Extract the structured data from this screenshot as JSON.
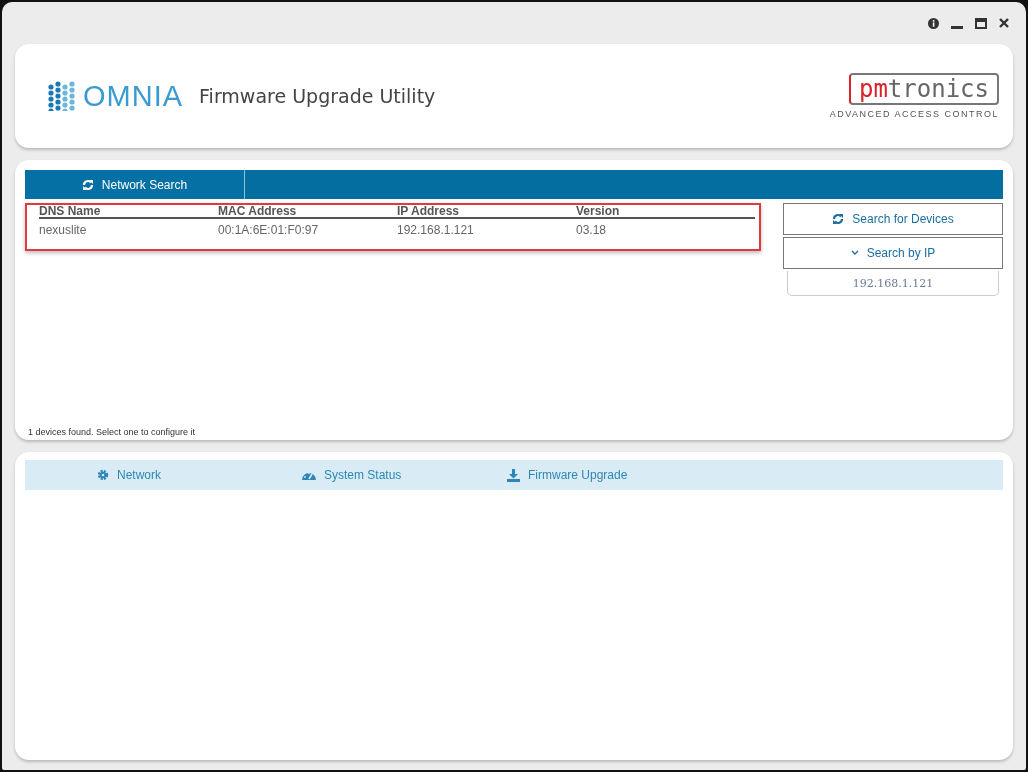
{
  "header": {
    "logo_text": "OMNIA",
    "title": "Firmware Upgrade Utility",
    "brand_prefix": "pm",
    "brand_suffix": "tronics",
    "brand_tagline": "ADVANCED ACCESS CONTROL"
  },
  "search_tabs": [
    {
      "label": "Network Search",
      "selected": true
    }
  ],
  "table": {
    "highlighted": true,
    "columns": [
      "DNS Name",
      "MAC Address",
      "IP Address",
      "Version"
    ],
    "rows": [
      [
        "nexuslite",
        "00:1A:6E:01:F0:97",
        "192.168.1.121",
        "03.18"
      ]
    ]
  },
  "search_for_devices": "Search for Devices",
  "search_by_ip": {
    "label": "Search by IP",
    "expanded": true,
    "value": "192.168.1.121"
  },
  "status": "1 devices found. Select one to configure it",
  "bottom_tabs": [
    {
      "label": "Network",
      "selected": false
    },
    {
      "label": "System Status",
      "selected": false
    },
    {
      "label": "Firmware Upgrade",
      "selected": false
    }
  ]
}
